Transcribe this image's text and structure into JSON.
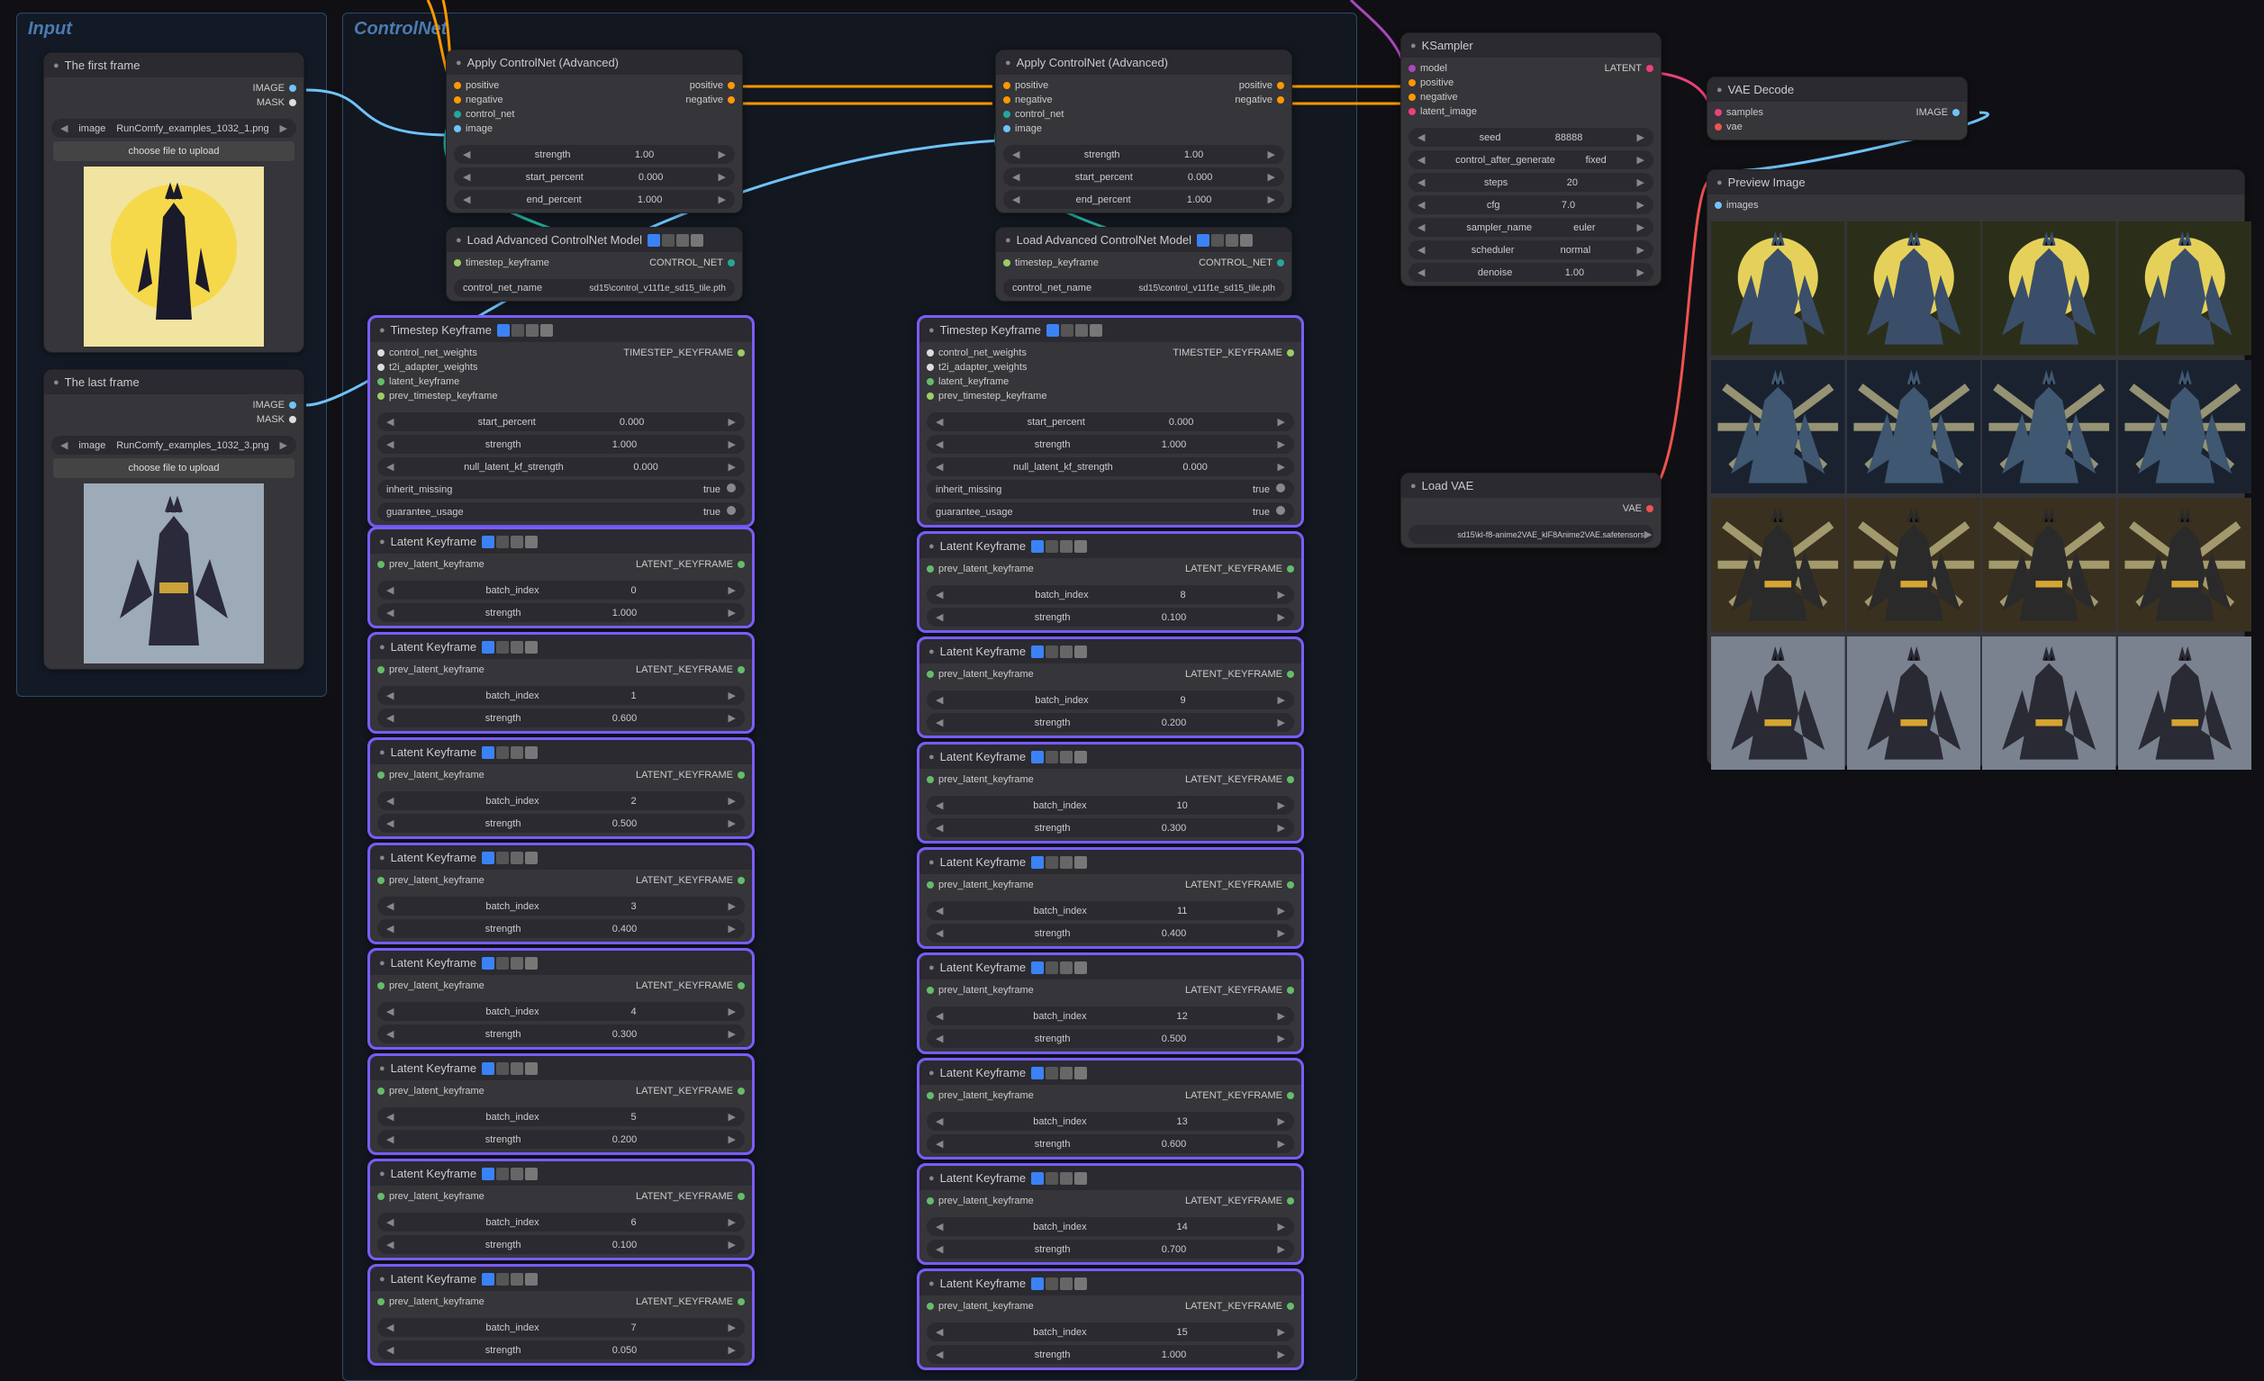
{
  "groups": {
    "input": {
      "title": "Input"
    },
    "controlnet": {
      "title": "ControlNet"
    }
  },
  "nodes": {
    "firstFrame": {
      "title": "The first frame",
      "out_image": "IMAGE",
      "out_mask": "MASK",
      "widget_image": "image",
      "image_value": "RunComfy_examples_1032_1.png",
      "upload_btn": "choose file to upload"
    },
    "lastFrame": {
      "title": "The last frame",
      "out_image": "IMAGE",
      "out_mask": "MASK",
      "widget_image": "image",
      "image_value": "RunComfy_examples_1032_3.png",
      "upload_btn": "choose file to upload"
    },
    "applyCN1": {
      "title": "Apply ControlNet (Advanced)",
      "in_positive": "positive",
      "in_negative": "negative",
      "in_control_net": "control_net",
      "in_image": "image",
      "out_positive": "positive",
      "out_negative": "negative",
      "w_strength": "strength",
      "w_strength_v": "1.00",
      "w_start": "start_percent",
      "w_start_v": "0.000",
      "w_end": "end_percent",
      "w_end_v": "1.000"
    },
    "applyCN2": {
      "title": "Apply ControlNet (Advanced)",
      "in_positive": "positive",
      "in_negative": "negative",
      "in_control_net": "control_net",
      "in_image": "image",
      "out_positive": "positive",
      "out_negative": "negative",
      "w_strength": "strength",
      "w_strength_v": "1.00",
      "w_start": "start_percent",
      "w_start_v": "0.000",
      "w_end": "end_percent",
      "w_end_v": "1.000"
    },
    "loadCN1": {
      "title": "Load Advanced ControlNet Model",
      "in_timestep": "timestep_keyframe",
      "out": "CONTROL_NET",
      "w_name": "control_net_name",
      "w_name_v": "sd15\\control_v11f1e_sd15_tile.pth"
    },
    "loadCN2": {
      "title": "Load Advanced ControlNet Model",
      "in_timestep": "timestep_keyframe",
      "out": "CONTROL_NET",
      "w_name": "control_net_name",
      "w_name_v": "sd15\\control_v11f1e_sd15_tile.pth"
    },
    "tkf1": {
      "title": "Timestep Keyframe",
      "in_cnw": "control_net_weights",
      "in_t2i": "t2i_adapter_weights",
      "in_lkf": "latent_keyframe",
      "in_prev": "prev_timestep_keyframe",
      "out": "TIMESTEP_KEYFRAME",
      "w_start": "start_percent",
      "w_start_v": "0.000",
      "w_strength": "strength",
      "w_strength_v": "1.000",
      "w_null": "null_latent_kf_strength",
      "w_null_v": "0.000",
      "w_inherit": "inherit_missing",
      "w_inherit_v": "true",
      "w_guar": "guarantee_usage",
      "w_guar_v": "true"
    },
    "tkf2": {
      "title": "Timestep Keyframe",
      "in_cnw": "control_net_weights",
      "in_t2i": "t2i_adapter_weights",
      "in_lkf": "latent_keyframe",
      "in_prev": "prev_timestep_keyframe",
      "out": "TIMESTEP_KEYFRAME",
      "w_start": "start_percent",
      "w_start_v": "0.000",
      "w_strength": "strength",
      "w_strength_v": "1.000",
      "w_null": "null_latent_kf_strength",
      "w_null_v": "0.000",
      "w_inherit": "inherit_missing",
      "w_inherit_v": "true",
      "w_guar": "guarantee_usage",
      "w_guar_v": "true"
    },
    "lkfA": [
      {
        "title": "Latent Keyframe",
        "in_prev": "prev_latent_keyframe",
        "out": "LATENT_KEYFRAME",
        "w_batch": "batch_index",
        "w_batch_v": "0",
        "w_strength": "strength",
        "w_strength_v": "1.000"
      },
      {
        "title": "Latent Keyframe",
        "in_prev": "prev_latent_keyframe",
        "out": "LATENT_KEYFRAME",
        "w_batch": "batch_index",
        "w_batch_v": "1",
        "w_strength": "strength",
        "w_strength_v": "0.600"
      },
      {
        "title": "Latent Keyframe",
        "in_prev": "prev_latent_keyframe",
        "out": "LATENT_KEYFRAME",
        "w_batch": "batch_index",
        "w_batch_v": "2",
        "w_strength": "strength",
        "w_strength_v": "0.500"
      },
      {
        "title": "Latent Keyframe",
        "in_prev": "prev_latent_keyframe",
        "out": "LATENT_KEYFRAME",
        "w_batch": "batch_index",
        "w_batch_v": "3",
        "w_strength": "strength",
        "w_strength_v": "0.400"
      },
      {
        "title": "Latent Keyframe",
        "in_prev": "prev_latent_keyframe",
        "out": "LATENT_KEYFRAME",
        "w_batch": "batch_index",
        "w_batch_v": "4",
        "w_strength": "strength",
        "w_strength_v": "0.300"
      },
      {
        "title": "Latent Keyframe",
        "in_prev": "prev_latent_keyframe",
        "out": "LATENT_KEYFRAME",
        "w_batch": "batch_index",
        "w_batch_v": "5",
        "w_strength": "strength",
        "w_strength_v": "0.200"
      },
      {
        "title": "Latent Keyframe",
        "in_prev": "prev_latent_keyframe",
        "out": "LATENT_KEYFRAME",
        "w_batch": "batch_index",
        "w_batch_v": "6",
        "w_strength": "strength",
        "w_strength_v": "0.100"
      },
      {
        "title": "Latent Keyframe",
        "in_prev": "prev_latent_keyframe",
        "out": "LATENT_KEYFRAME",
        "w_batch": "batch_index",
        "w_batch_v": "7",
        "w_strength": "strength",
        "w_strength_v": "0.050"
      }
    ],
    "lkfB": [
      {
        "title": "Latent Keyframe",
        "in_prev": "prev_latent_keyframe",
        "out": "LATENT_KEYFRAME",
        "w_batch": "batch_index",
        "w_batch_v": "8",
        "w_strength": "strength",
        "w_strength_v": "0.100"
      },
      {
        "title": "Latent Keyframe",
        "in_prev": "prev_latent_keyframe",
        "out": "LATENT_KEYFRAME",
        "w_batch": "batch_index",
        "w_batch_v": "9",
        "w_strength": "strength",
        "w_strength_v": "0.200"
      },
      {
        "title": "Latent Keyframe",
        "in_prev": "prev_latent_keyframe",
        "out": "LATENT_KEYFRAME",
        "w_batch": "batch_index",
        "w_batch_v": "10",
        "w_strength": "strength",
        "w_strength_v": "0.300"
      },
      {
        "title": "Latent Keyframe",
        "in_prev": "prev_latent_keyframe",
        "out": "LATENT_KEYFRAME",
        "w_batch": "batch_index",
        "w_batch_v": "11",
        "w_strength": "strength",
        "w_strength_v": "0.400"
      },
      {
        "title": "Latent Keyframe",
        "in_prev": "prev_latent_keyframe",
        "out": "LATENT_KEYFRAME",
        "w_batch": "batch_index",
        "w_batch_v": "12",
        "w_strength": "strength",
        "w_strength_v": "0.500"
      },
      {
        "title": "Latent Keyframe",
        "in_prev": "prev_latent_keyframe",
        "out": "LATENT_KEYFRAME",
        "w_batch": "batch_index",
        "w_batch_v": "13",
        "w_strength": "strength",
        "w_strength_v": "0.600"
      },
      {
        "title": "Latent Keyframe",
        "in_prev": "prev_latent_keyframe",
        "out": "LATENT_KEYFRAME",
        "w_batch": "batch_index",
        "w_batch_v": "14",
        "w_strength": "strength",
        "w_strength_v": "0.700"
      },
      {
        "title": "Latent Keyframe",
        "in_prev": "prev_latent_keyframe",
        "out": "LATENT_KEYFRAME",
        "w_batch": "batch_index",
        "w_batch_v": "15",
        "w_strength": "strength",
        "w_strength_v": "1.000"
      }
    ],
    "ksampler": {
      "title": "KSampler",
      "in_model": "model",
      "in_positive": "positive",
      "in_negative": "negative",
      "in_latent": "latent_image",
      "out": "LATENT",
      "w_seed": "seed",
      "w_seed_v": "88888",
      "w_cag": "control_after_generate",
      "w_cag_v": "fixed",
      "w_steps": "steps",
      "w_steps_v": "20",
      "w_cfg": "cfg",
      "w_cfg_v": "7.0",
      "w_sampler": "sampler_name",
      "w_sampler_v": "euler",
      "w_sched": "scheduler",
      "w_sched_v": "normal",
      "w_denoise": "denoise",
      "w_denoise_v": "1.00"
    },
    "loadVAE": {
      "title": "Load VAE",
      "out": "VAE",
      "w_name": "vae_name",
      "w_name_v": "sd15\\kl-f8-anime2VAE_klF8Anime2VAE.safetensors"
    },
    "vaeDecode": {
      "title": "VAE Decode",
      "in_samples": "samples",
      "in_vae": "vae",
      "out": "IMAGE"
    },
    "preview": {
      "title": "Preview Image",
      "in_images": "images"
    }
  }
}
